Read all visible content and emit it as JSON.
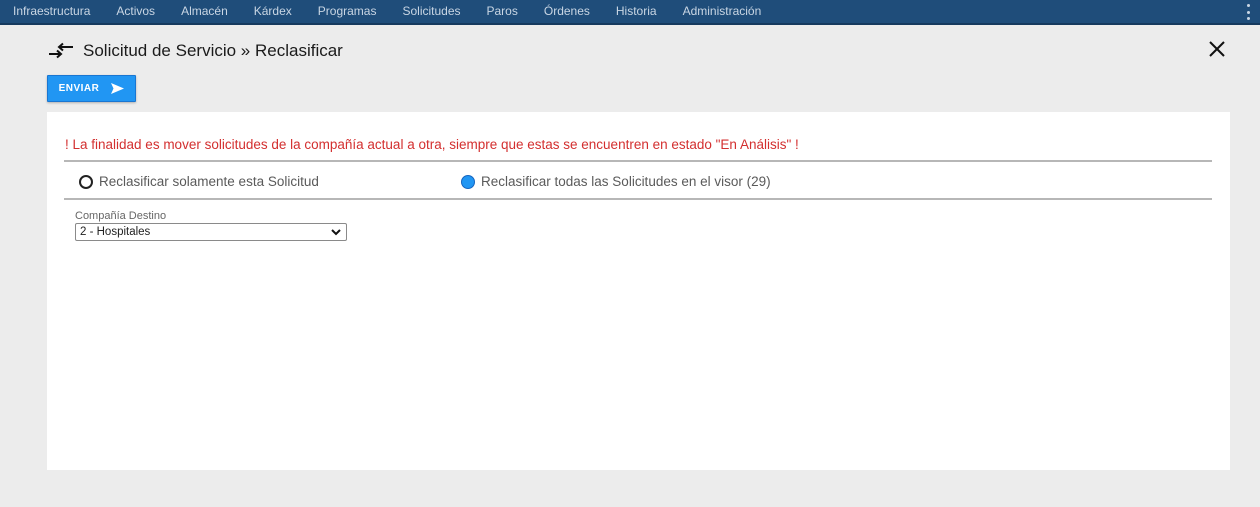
{
  "nav": {
    "items": [
      "Infraestructura",
      "Activos",
      "Almacén",
      "Kárdex",
      "Programas",
      "Solicitudes",
      "Paros",
      "Órdenes",
      "Historia",
      "Administración"
    ]
  },
  "header": {
    "title": "Solicitud de Servicio » Reclasificar"
  },
  "toolbar": {
    "send_label": "ENVIAR"
  },
  "form": {
    "warning": "! La finalidad es mover solicitudes de la compañía actual a otra, siempre que estas se encuentren en estado \"En Análisis\" !",
    "options": [
      {
        "label": "Reclasificar solamente esta Solicitud",
        "selected": false
      },
      {
        "label": "Reclasificar todas las Solicitudes en el visor (29)",
        "selected": true
      }
    ],
    "company_label": "Compañía Destino",
    "company_value": "2 - Hospitales"
  },
  "colors": {
    "nav_bg": "#1f4d7a",
    "accent": "#2196f3",
    "warning": "#d32f2f"
  }
}
